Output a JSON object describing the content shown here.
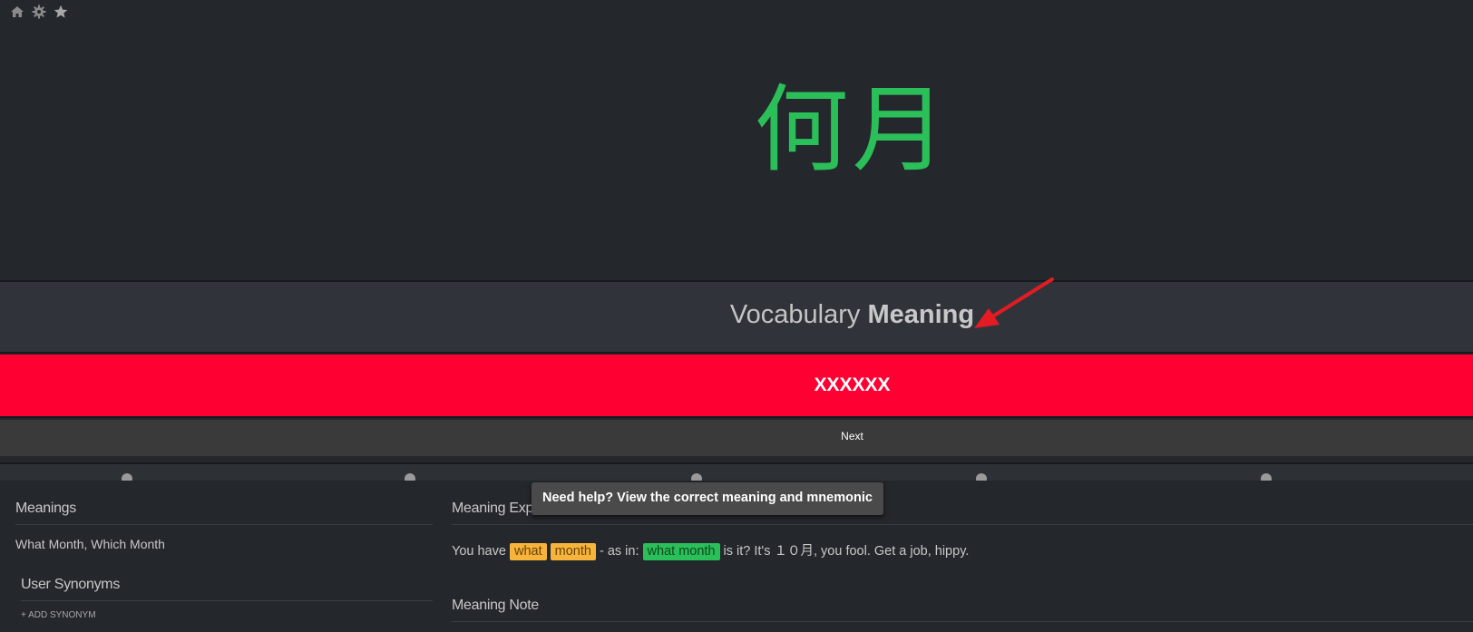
{
  "top_icons": [
    {
      "name": "home-icon"
    },
    {
      "name": "gear-icon"
    },
    {
      "name": "star-icon"
    }
  ],
  "character": "何月",
  "question": {
    "type": "Vocabulary",
    "category": "Meaning"
  },
  "answer": {
    "value": "XXXXXX",
    "state_color": "#ff0033"
  },
  "next_label": "Next",
  "meanings": {
    "title": "Meanings",
    "text": "What Month, Which Month"
  },
  "user_synonyms": {
    "title": "User Synonyms",
    "add_label": "+ ADD SYNONYM"
  },
  "meaning_explanation": {
    "title": "Meaning Expl",
    "parts": {
      "p1": "You have ",
      "hl1": "what",
      "hl2": "month",
      "p2": " - as in: ",
      "hl3": "what month",
      "p3": " is it? It's １０月, you fool. Get a job, hippy."
    }
  },
  "meaning_note": {
    "title": "Meaning Note"
  },
  "tooltip": "Need help? View the correct meaning and mnemonic",
  "colors": {
    "background": "#24272b",
    "character": "#2bbf5a",
    "incorrect": "#ff0033",
    "highlight_orange": "#f6b43d",
    "highlight_green": "#2bbf5a",
    "arrow": "#e31b23"
  }
}
